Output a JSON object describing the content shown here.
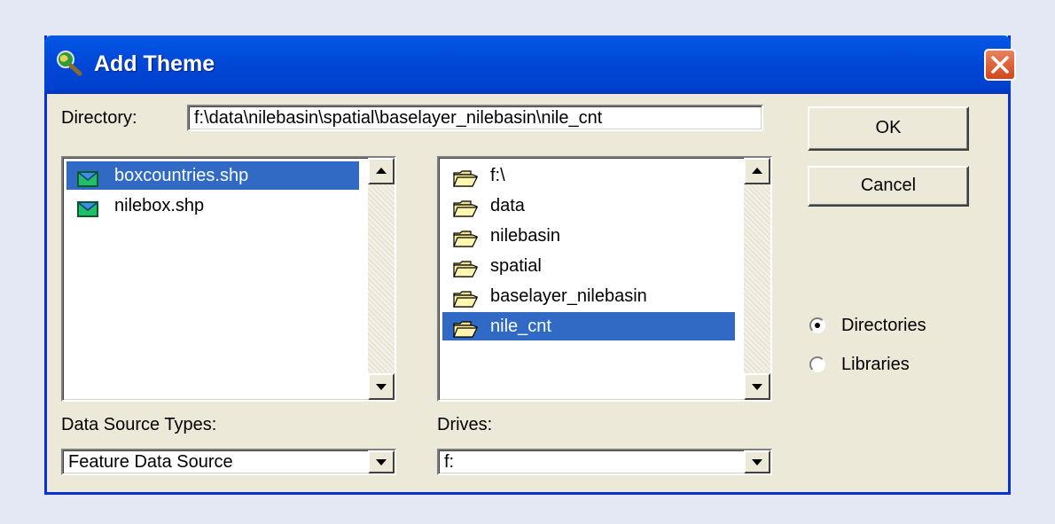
{
  "window": {
    "title": "Add Theme",
    "title_icon": "magnifier-globe-icon"
  },
  "directory": {
    "label": "Directory:",
    "value": "f:\\data\\nilebasin\\spatial\\baselayer_nilebasin\\nile_cnt"
  },
  "buttons": {
    "ok": "OK",
    "cancel": "Cancel"
  },
  "file_list": {
    "items": [
      {
        "label": "boxcountries.shp",
        "icon": "shapefile-icon",
        "selected": true
      },
      {
        "label": "nilebox.shp",
        "icon": "shapefile-icon",
        "selected": false
      }
    ]
  },
  "folder_list": {
    "items": [
      {
        "label": "f:\\",
        "icon": "open-folder-icon"
      },
      {
        "label": "data",
        "icon": "open-folder-icon"
      },
      {
        "label": "nilebasin",
        "icon": "open-folder-icon"
      },
      {
        "label": "spatial",
        "icon": "open-folder-icon"
      },
      {
        "label": "baselayer_nilebasin",
        "icon": "open-folder-icon"
      },
      {
        "label": "nile_cnt",
        "icon": "open-folder-icon",
        "selected": true
      }
    ]
  },
  "data_source_types": {
    "label": "Data Source Types:",
    "value": "Feature Data Source"
  },
  "drives": {
    "label": "Drives:",
    "value": "f:"
  },
  "source_mode": {
    "directories": "Directories",
    "libraries": "Libraries",
    "selected": "directories"
  },
  "colors": {
    "title_bar": "#0047d6",
    "selection": "#316ac5",
    "dialog_bg": "#ece9d8",
    "page_bg": "#e4e8f4"
  }
}
